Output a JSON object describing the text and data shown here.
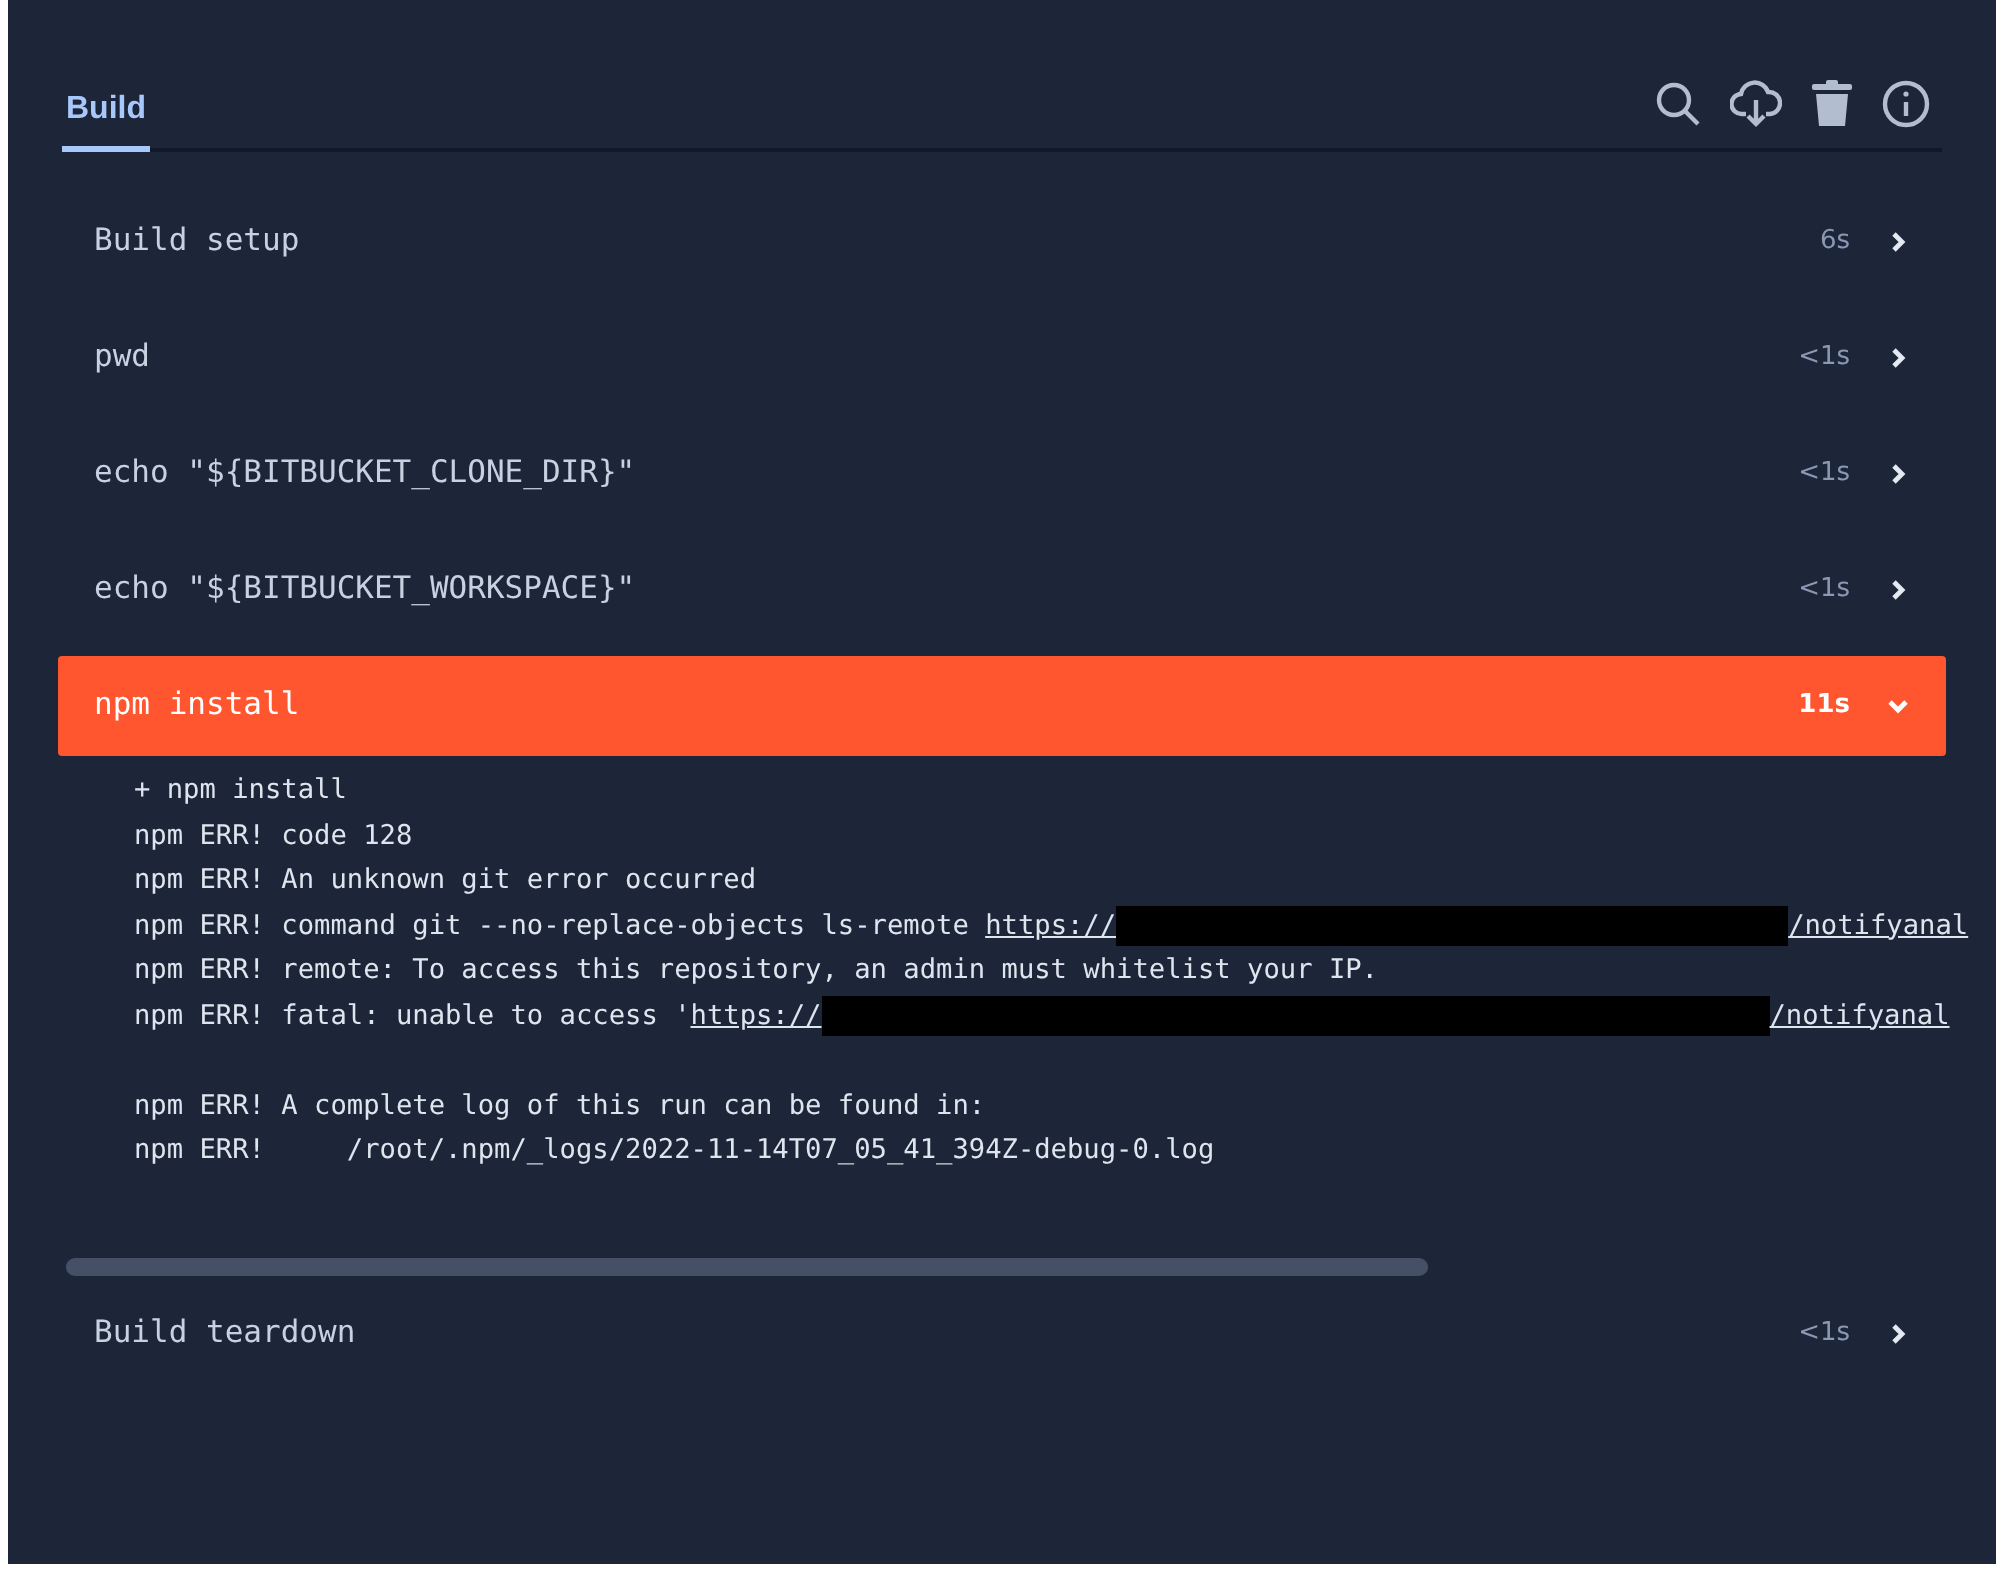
{
  "tabs": [
    {
      "label": "Build",
      "selected": true
    }
  ],
  "steps": [
    {
      "label": "Build setup",
      "duration": "6s",
      "expanded": false,
      "failed": false
    },
    {
      "label": "pwd",
      "duration": "<1s",
      "expanded": false,
      "failed": false
    },
    {
      "label": "echo \"${BITBUCKET_CLONE_DIR}\"",
      "duration": "<1s",
      "expanded": false,
      "failed": false
    },
    {
      "label": "echo \"${BITBUCKET_WORKSPACE}\"",
      "duration": "<1s",
      "expanded": false,
      "failed": false
    },
    {
      "label": "npm install",
      "duration": "11s",
      "expanded": true,
      "failed": true,
      "log": [
        [
          {
            "kind": "text",
            "text": "+ npm install"
          }
        ],
        [
          {
            "kind": "text",
            "text": "npm ERR! code 128"
          }
        ],
        [
          {
            "kind": "text",
            "text": "npm ERR! An unknown git error occurred"
          }
        ],
        [
          {
            "kind": "text",
            "text": "npm ERR! command git --no-replace-objects ls-remote "
          },
          {
            "kind": "link",
            "text": "https://"
          },
          {
            "kind": "redacted"
          },
          {
            "kind": "link",
            "text": "/notifyanal"
          }
        ],
        [
          {
            "kind": "text",
            "text": "npm ERR! remote: To access this repository, an admin must whitelist your IP."
          }
        ],
        [
          {
            "kind": "text",
            "text": "npm ERR! fatal: unable to access '"
          },
          {
            "kind": "link",
            "text": "https://"
          },
          {
            "kind": "redacted"
          },
          {
            "kind": "link",
            "text": "/notifyanal"
          }
        ],
        [
          {
            "kind": "blank"
          }
        ],
        [
          {
            "kind": "text",
            "text": "npm ERR! A complete log of this run can be found in:"
          }
        ],
        [
          {
            "kind": "text",
            "text": "npm ERR!     /root/.npm/_logs/2022-11-14T07_05_41_394Z-debug-0.log"
          }
        ]
      ]
    },
    {
      "label": "Build teardown",
      "duration": "<1s",
      "expanded": false,
      "failed": false
    }
  ]
}
